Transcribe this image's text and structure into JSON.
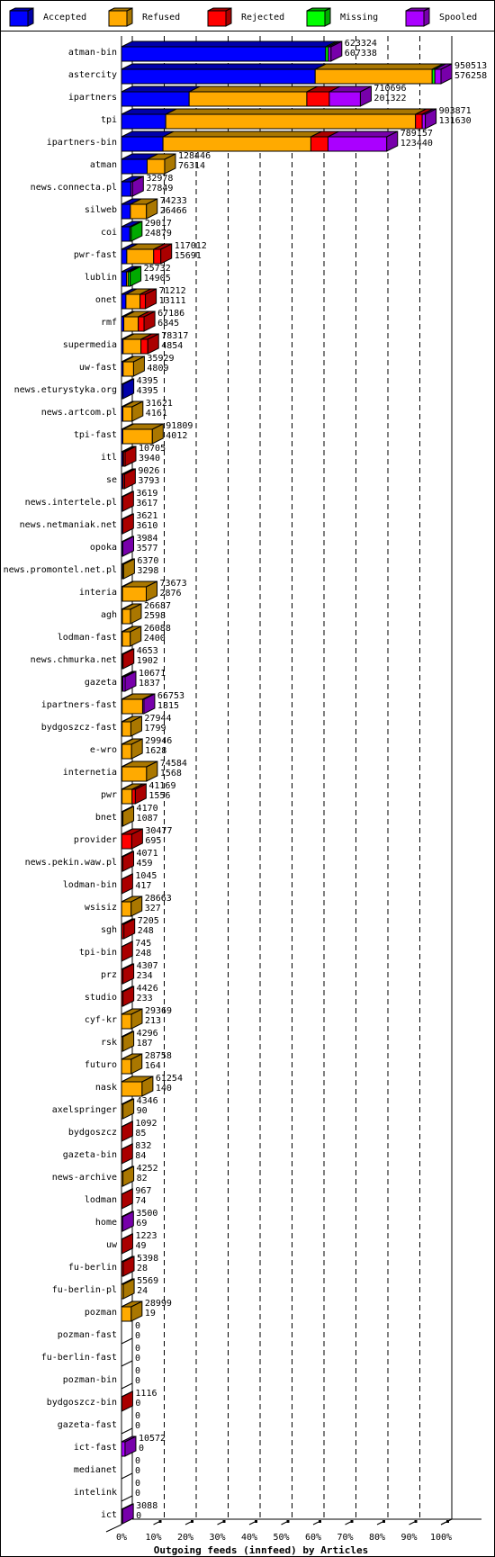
{
  "legend": [
    {
      "label": "Accepted",
      "color": "#0000ff",
      "side": "#0000aa"
    },
    {
      "label": "Refused",
      "color": "#ffaa00",
      "side": "#aa7700"
    },
    {
      "label": "Rejected",
      "color": "#ff0000",
      "side": "#aa0000"
    },
    {
      "label": "Missing",
      "color": "#00ff00",
      "side": "#00aa00"
    },
    {
      "label": "Spooled",
      "color": "#aa00ff",
      "side": "#7700aa"
    }
  ],
  "chart_data": {
    "type": "bar",
    "orientation": "horizontal",
    "stacked": true,
    "title": "Outgoing feeds (innfeed) by Articles",
    "xlabel": "Outgoing feeds (innfeed) by Articles",
    "x_ticks": [
      "0%",
      "10%",
      "20%",
      "30%",
      "40%",
      "50%",
      "60%",
      "70%",
      "80%",
      "90%",
      "100%"
    ],
    "xlim": [
      0,
      100
    ],
    "max_total": 950513,
    "series_names": [
      "Accepted",
      "Refused",
      "Rejected",
      "Missing",
      "Spooled"
    ],
    "rows": [
      {
        "name": "atman-bin",
        "total": 623324,
        "accepted": 607338,
        "segments": [
          607338,
          0,
          0,
          8000,
          7986
        ]
      },
      {
        "name": "astercity",
        "total": 950513,
        "accepted": 576258,
        "segments": [
          576258,
          348000,
          0,
          8000,
          18255
        ]
      },
      {
        "name": "ipartners",
        "total": 710696,
        "accepted": 201322,
        "segments": [
          201322,
          350000,
          67000,
          0,
          92374
        ]
      },
      {
        "name": "tpi",
        "total": 903871,
        "accepted": 131630,
        "segments": [
          131630,
          743000,
          20000,
          0,
          9241
        ]
      },
      {
        "name": "ipartners-bin",
        "total": 789157,
        "accepted": 123440,
        "segments": [
          123440,
          440000,
          51000,
          0,
          174717
        ]
      },
      {
        "name": "atman",
        "total": 128446,
        "accepted": 76314,
        "segments": [
          76314,
          52132,
          0,
          0,
          0
        ]
      },
      {
        "name": "news.connecta.pl",
        "total": 32978,
        "accepted": 27849,
        "segments": [
          27849,
          0,
          0,
          0,
          5129
        ]
      },
      {
        "name": "silweb",
        "total": 74233,
        "accepted": 26466,
        "segments": [
          26466,
          47767,
          0,
          0,
          0
        ]
      },
      {
        "name": "coi",
        "total": 29017,
        "accepted": 24879,
        "segments": [
          24879,
          0,
          0,
          4138,
          0
        ]
      },
      {
        "name": "pwr-fast",
        "total": 117012,
        "accepted": 15691,
        "segments": [
          15691,
          80000,
          21321,
          0,
          0
        ]
      },
      {
        "name": "lublin",
        "total": 25732,
        "accepted": 14905,
        "segments": [
          14905,
          5000,
          0,
          5827,
          0
        ]
      },
      {
        "name": "onet",
        "total": 71212,
        "accepted": 13111,
        "segments": [
          13111,
          42000,
          16101,
          0,
          0
        ]
      },
      {
        "name": "rmf",
        "total": 67186,
        "accepted": 6845,
        "segments": [
          6845,
          43000,
          17341,
          0,
          0
        ]
      },
      {
        "name": "supermedia",
        "total": 78317,
        "accepted": 4854,
        "segments": [
          4854,
          53000,
          20463,
          0,
          0
        ]
      },
      {
        "name": "uw-fast",
        "total": 35929,
        "accepted": 4809,
        "segments": [
          4809,
          31120,
          0,
          0,
          0
        ]
      },
      {
        "name": "news.eturystyka.org",
        "total": 4395,
        "accepted": 4395,
        "segments": [
          4395,
          0,
          0,
          0,
          0
        ]
      },
      {
        "name": "news.artcom.pl",
        "total": 31621,
        "accepted": 4161,
        "segments": [
          4161,
          27460,
          0,
          0,
          0
        ]
      },
      {
        "name": "tpi-fast",
        "total": 91809,
        "accepted": 4012,
        "segments": [
          4012,
          87797,
          0,
          0,
          0
        ]
      },
      {
        "name": "itl",
        "total": 10705,
        "accepted": 3940,
        "segments": [
          3940,
          2000,
          4765,
          0,
          0
        ]
      },
      {
        "name": "se",
        "total": 9026,
        "accepted": 3793,
        "segments": [
          3793,
          500,
          4733,
          0,
          0
        ]
      },
      {
        "name": "news.intertele.pl",
        "total": 3619,
        "accepted": 3617,
        "segments": [
          3617,
          0,
          2,
          0,
          0
        ]
      },
      {
        "name": "news.netmaniak.net",
        "total": 3621,
        "accepted": 3610,
        "segments": [
          3610,
          0,
          11,
          0,
          0
        ]
      },
      {
        "name": "opoka",
        "total": 3984,
        "accepted": 3577,
        "segments": [
          3577,
          0,
          0,
          0,
          407
        ]
      },
      {
        "name": "news.promontel.net.pl",
        "total": 6370,
        "accepted": 3298,
        "segments": [
          3298,
          3072,
          0,
          0,
          0
        ]
      },
      {
        "name": "interia",
        "total": 73673,
        "accepted": 2876,
        "segments": [
          2876,
          70797,
          0,
          0,
          0
        ]
      },
      {
        "name": "agh",
        "total": 26687,
        "accepted": 2598,
        "segments": [
          2598,
          24089,
          0,
          0,
          0
        ]
      },
      {
        "name": "lodman-fast",
        "total": 26088,
        "accepted": 2400,
        "segments": [
          2400,
          23688,
          0,
          0,
          0
        ]
      },
      {
        "name": "news.chmurka.net",
        "total": 4653,
        "accepted": 1902,
        "segments": [
          1902,
          0,
          2751,
          0,
          0
        ]
      },
      {
        "name": "gazeta",
        "total": 10671,
        "accepted": 1837,
        "segments": [
          1837,
          2500,
          0,
          0,
          6334
        ]
      },
      {
        "name": "ipartners-fast",
        "total": 66753,
        "accepted": 1815,
        "segments": [
          1815,
          61000,
          0,
          0,
          3938
        ]
      },
      {
        "name": "bydgoszcz-fast",
        "total": 27944,
        "accepted": 1799,
        "segments": [
          1799,
          26145,
          0,
          0,
          0
        ]
      },
      {
        "name": "e-wro",
        "total": 29946,
        "accepted": 1628,
        "segments": [
          1628,
          28318,
          0,
          0,
          0
        ]
      },
      {
        "name": "internetia",
        "total": 74584,
        "accepted": 1568,
        "segments": [
          1568,
          73016,
          0,
          0,
          0
        ]
      },
      {
        "name": "pwr",
        "total": 41169,
        "accepted": 1556,
        "segments": [
          1556,
          30000,
          9613,
          0,
          0
        ]
      },
      {
        "name": "bnet",
        "total": 4170,
        "accepted": 1087,
        "segments": [
          1087,
          3083,
          0,
          0,
          0
        ]
      },
      {
        "name": "provider",
        "total": 30477,
        "accepted": 695,
        "segments": [
          695,
          0,
          29782,
          0,
          0
        ]
      },
      {
        "name": "news.pekin.waw.pl",
        "total": 4071,
        "accepted": 459,
        "segments": [
          459,
          0,
          3612,
          0,
          0
        ]
      },
      {
        "name": "lodman-bin",
        "total": 1045,
        "accepted": 417,
        "segments": [
          417,
          0,
          628,
          0,
          0
        ]
      },
      {
        "name": "wsisiz",
        "total": 28663,
        "accepted": 327,
        "segments": [
          327,
          28336,
          0,
          0,
          0
        ]
      },
      {
        "name": "sgh",
        "total": 7205,
        "accepted": 248,
        "segments": [
          248,
          1000,
          5957,
          0,
          0
        ]
      },
      {
        "name": "tpi-bin",
        "total": 745,
        "accepted": 248,
        "segments": [
          248,
          0,
          497,
          0,
          0
        ]
      },
      {
        "name": "prz",
        "total": 4307,
        "accepted": 234,
        "segments": [
          234,
          0,
          4073,
          0,
          0
        ]
      },
      {
        "name": "studio",
        "total": 4426,
        "accepted": 233,
        "segments": [
          233,
          0,
          4193,
          0,
          0
        ]
      },
      {
        "name": "cyf-kr",
        "total": 29369,
        "accepted": 213,
        "segments": [
          213,
          29156,
          0,
          0,
          0
        ]
      },
      {
        "name": "rsk",
        "total": 4296,
        "accepted": 187,
        "segments": [
          187,
          4109,
          0,
          0,
          0
        ]
      },
      {
        "name": "futuro",
        "total": 28758,
        "accepted": 164,
        "segments": [
          164,
          28594,
          0,
          0,
          0
        ]
      },
      {
        "name": "nask",
        "total": 61254,
        "accepted": 140,
        "segments": [
          140,
          61114,
          0,
          0,
          0
        ]
      },
      {
        "name": "axelspringer",
        "total": 4346,
        "accepted": 90,
        "segments": [
          90,
          4256,
          0,
          0,
          0
        ]
      },
      {
        "name": "bydgoszcz",
        "total": 1092,
        "accepted": 85,
        "segments": [
          85,
          0,
          1007,
          0,
          0
        ]
      },
      {
        "name": "gazeta-bin",
        "total": 832,
        "accepted": 84,
        "segments": [
          84,
          0,
          748,
          0,
          0
        ]
      },
      {
        "name": "news-archive",
        "total": 4252,
        "accepted": 82,
        "segments": [
          82,
          4170,
          0,
          0,
          0
        ]
      },
      {
        "name": "lodman",
        "total": 967,
        "accepted": 74,
        "segments": [
          74,
          0,
          893,
          0,
          0
        ]
      },
      {
        "name": "home",
        "total": 3500,
        "accepted": 69,
        "segments": [
          69,
          0,
          0,
          0,
          3431
        ]
      },
      {
        "name": "uw",
        "total": 1223,
        "accepted": 49,
        "segments": [
          49,
          0,
          1174,
          0,
          0
        ]
      },
      {
        "name": "fu-berlin",
        "total": 5398,
        "accepted": 28,
        "segments": [
          28,
          900,
          4470,
          0,
          0
        ]
      },
      {
        "name": "fu-berlin-pl",
        "total": 5569,
        "accepted": 24,
        "segments": [
          24,
          5545,
          0,
          0,
          0
        ]
      },
      {
        "name": "pozman",
        "total": 28999,
        "accepted": 19,
        "segments": [
          19,
          28980,
          0,
          0,
          0
        ]
      },
      {
        "name": "pozman-fast",
        "total": 0,
        "accepted": 0,
        "segments": [
          0,
          0,
          0,
          0,
          0
        ]
      },
      {
        "name": "fu-berlin-fast",
        "total": 0,
        "accepted": 0,
        "segments": [
          0,
          0,
          0,
          0,
          0
        ]
      },
      {
        "name": "pozman-bin",
        "total": 0,
        "accepted": 0,
        "segments": [
          0,
          0,
          0,
          0,
          0
        ]
      },
      {
        "name": "bydgoszcz-bin",
        "total": 1116,
        "accepted": 0,
        "segments": [
          0,
          0,
          1116,
          0,
          0
        ]
      },
      {
        "name": "gazeta-fast",
        "total": 0,
        "accepted": 0,
        "segments": [
          0,
          0,
          0,
          0,
          0
        ]
      },
      {
        "name": "ict-fast",
        "total": 10572,
        "accepted": 0,
        "segments": [
          0,
          0,
          0,
          0,
          10572
        ]
      },
      {
        "name": "medianet",
        "total": 0,
        "accepted": 0,
        "segments": [
          0,
          0,
          0,
          0,
          0
        ]
      },
      {
        "name": "intelink",
        "total": 0,
        "accepted": 0,
        "segments": [
          0,
          0,
          0,
          0,
          0
        ]
      },
      {
        "name": "ict",
        "total": 3088,
        "accepted": 0,
        "segments": [
          0,
          0,
          0,
          0,
          3088
        ]
      }
    ]
  }
}
